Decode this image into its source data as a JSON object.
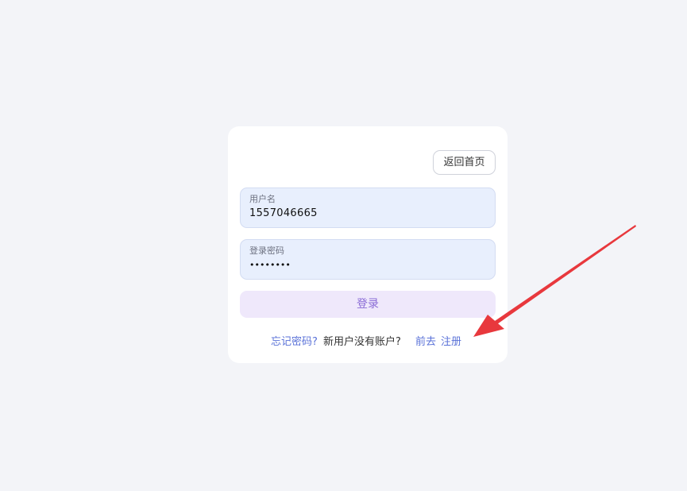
{
  "header": {
    "home_label": "返回首页"
  },
  "form": {
    "username": {
      "label": "用户名",
      "value": "1557046665"
    },
    "password": {
      "label": "登录密码",
      "value": "••••••••"
    },
    "submit_label": "登录"
  },
  "footer": {
    "forgot_label": "忘记密码?",
    "no_account_text": "新用户没有账户?",
    "go_label": "前去",
    "register_label": "注册"
  },
  "colors": {
    "background": "#f3f4f8",
    "card": "#ffffff",
    "field_bg": "#e8effd",
    "login_bg": "#efe8fb",
    "login_text": "#8a6bd6",
    "link": "#5a72d8",
    "annotation_arrow": "#e8383d"
  },
  "icons": {
    "annotation": "red-arrow-icon"
  }
}
